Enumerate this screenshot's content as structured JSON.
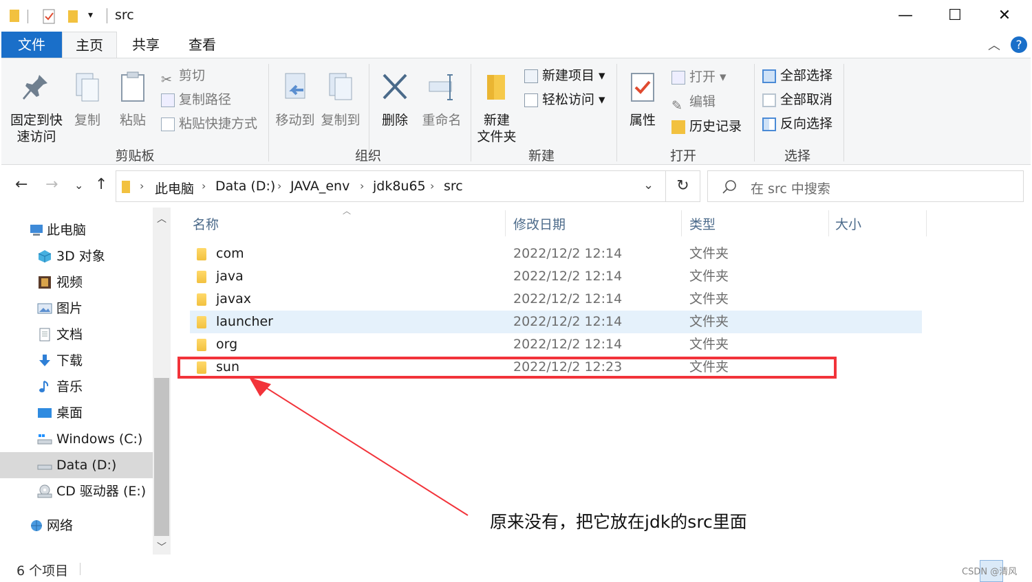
{
  "title": "src",
  "window_controls": {
    "minimize": "—",
    "maximize": "☐",
    "close": "✕"
  },
  "tabs": [
    "文件",
    "主页",
    "共享",
    "查看"
  ],
  "ribbon": {
    "clipboard": {
      "label": "剪贴板",
      "pin_line1": "固定到快",
      "pin_line2": "速访问",
      "copy": "复制",
      "paste": "粘贴",
      "cut": "剪切",
      "copy_path": "复制路径",
      "paste_shortcut": "粘贴快捷方式"
    },
    "organize": {
      "label": "组织",
      "move_to": "移动到",
      "copy_to": "复制到",
      "delete": "删除",
      "rename": "重命名"
    },
    "new": {
      "label": "新建",
      "new_item": "新建项目",
      "easy_access": "轻松访问",
      "new_folder_line1": "新建",
      "new_folder_line2": "文件夹"
    },
    "open": {
      "label": "打开",
      "properties": "属性",
      "open": "打开",
      "edit": "编辑",
      "history": "历史记录"
    },
    "select": {
      "label": "选择",
      "select_all": "全部选择",
      "select_none": "全部取消",
      "invert": "反向选择"
    }
  },
  "breadcrumb": [
    "此电脑",
    "Data (D:)",
    "JAVA_env",
    "jdk8u65",
    "src"
  ],
  "search": {
    "placeholder": "在 src 中搜索"
  },
  "nav_pane": [
    {
      "label": "此电脑",
      "icon": "computer-icon"
    },
    {
      "label": "3D 对象",
      "icon": "cube-icon"
    },
    {
      "label": "视频",
      "icon": "video-icon"
    },
    {
      "label": "图片",
      "icon": "picture-icon"
    },
    {
      "label": "文档",
      "icon": "document-icon"
    },
    {
      "label": "下载",
      "icon": "download-icon"
    },
    {
      "label": "音乐",
      "icon": "music-icon"
    },
    {
      "label": "桌面",
      "icon": "desktop-icon"
    },
    {
      "label": "Windows (C:)",
      "icon": "drive-icon"
    },
    {
      "label": "Data (D:)",
      "icon": "drive-icon"
    },
    {
      "label": "CD 驱动器 (E:)",
      "icon": "cd-drive-icon"
    },
    {
      "label": "网络",
      "icon": "network-icon"
    }
  ],
  "columns": [
    "名称",
    "修改日期",
    "类型",
    "大小"
  ],
  "files": [
    {
      "name": "com",
      "date": "2022/12/2 12:14",
      "type": "文件夹"
    },
    {
      "name": "java",
      "date": "2022/12/2 12:14",
      "type": "文件夹"
    },
    {
      "name": "javax",
      "date": "2022/12/2 12:14",
      "type": "文件夹"
    },
    {
      "name": "launcher",
      "date": "2022/12/2 12:14",
      "type": "文件夹"
    },
    {
      "name": "org",
      "date": "2022/12/2 12:14",
      "type": "文件夹"
    },
    {
      "name": "sun",
      "date": "2022/12/2 12:23",
      "type": "文件夹"
    }
  ],
  "annotation": "原来没有，把它放在jdk的src里面",
  "status": "6 个项目",
  "watermark": "CSDN @清风",
  "colors": {
    "accent": "#1a6fc9",
    "highlight_row": "#e5f1fb",
    "annotation_red": "#f2333a",
    "folder": "#f2c13f"
  }
}
